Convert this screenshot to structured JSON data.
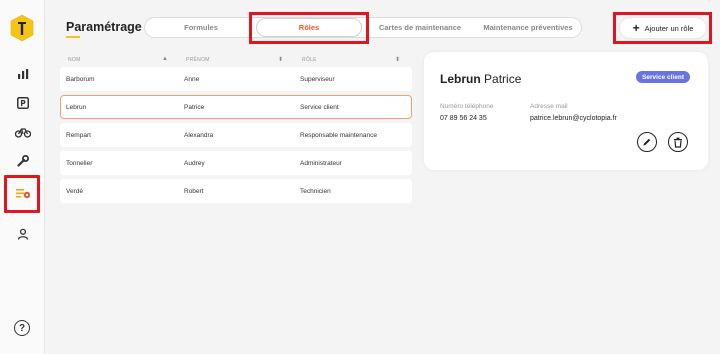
{
  "header": {
    "title": "Paramétrage"
  },
  "tabs": [
    {
      "label": "Formules"
    },
    {
      "label": "Rôles"
    },
    {
      "label": "Cartes de maintenance"
    },
    {
      "label": "Maintenance préventives"
    }
  ],
  "actions": {
    "add_label": "Ajouter un rôle"
  },
  "table": {
    "columns": [
      "NOM",
      "PRÉNOM",
      "RÔLE"
    ],
    "rows": [
      {
        "nom": "Barborum",
        "prenom": "Anne",
        "role": "Superviseur"
      },
      {
        "nom": "Lebrun",
        "prenom": "Patrice",
        "role": "Service client"
      },
      {
        "nom": "Rempart",
        "prenom": "Alexandra",
        "role": "Responsable maintenance"
      },
      {
        "nom": "Tonnelier",
        "prenom": "Audrey",
        "role": "Administrateur"
      },
      {
        "nom": "Verdé",
        "prenom": "Robert",
        "role": "Technicien"
      }
    ],
    "selected_index": 1
  },
  "detail": {
    "last_name": "Lebrun",
    "first_name": "Patrice",
    "role_badge": "Service client",
    "phone_label": "Numéro téléphone",
    "phone": "07 89 56 24 35",
    "email_label": "Adresse mail",
    "email": "patrice.lebrun@cyclotopia.fr"
  },
  "sidebar": {
    "items": [
      "logo-icon",
      "chart-icon",
      "parking-icon",
      "bike-icon",
      "wrench-icon",
      "settings-list-icon",
      "user-icon"
    ],
    "help": "?"
  },
  "colors": {
    "accent": "#f5c414",
    "active_tab_text": "#e05a2b",
    "badge": "#6a72e8",
    "highlight": "#e0151d",
    "selected_row_border": "#f0a070"
  }
}
